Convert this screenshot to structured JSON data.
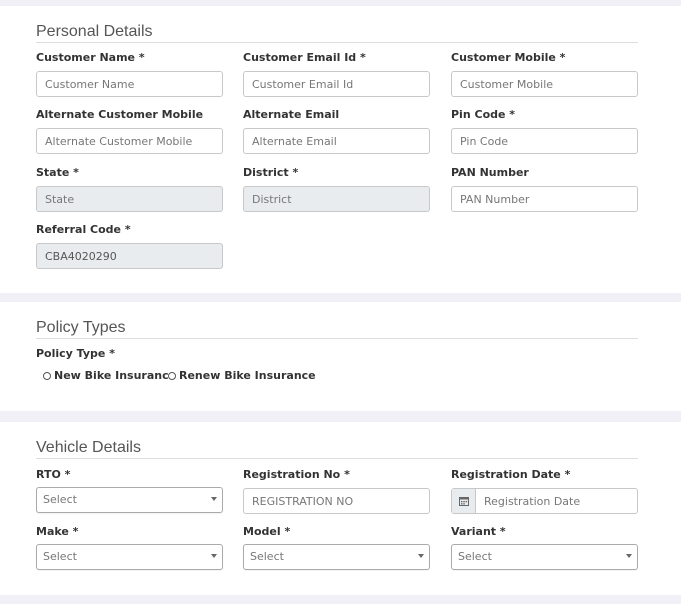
{
  "personal": {
    "title": "Personal Details",
    "fields": {
      "customer_name": {
        "label": "Customer Name *",
        "placeholder": "Customer Name"
      },
      "customer_email": {
        "label": "Customer Email Id *",
        "placeholder": "Customer Email Id"
      },
      "customer_mobile": {
        "label": "Customer Mobile *",
        "placeholder": "Customer Mobile"
      },
      "alt_mobile": {
        "label": "Alternate Customer Mobile",
        "placeholder": "Alternate Customer Mobile"
      },
      "alt_email": {
        "label": "Alternate Email",
        "placeholder": "Alternate Email"
      },
      "pin_code": {
        "label": "Pin Code *",
        "placeholder": "Pin Code"
      },
      "state": {
        "label": "State *",
        "placeholder": "State"
      },
      "district": {
        "label": "District *",
        "placeholder": "District"
      },
      "pan": {
        "label": "PAN Number",
        "placeholder": "PAN Number"
      },
      "referral": {
        "label": "Referral Code *",
        "value": "CBA4020290"
      }
    }
  },
  "policy": {
    "title": "Policy Types",
    "policy_type_label": "Policy Type *",
    "options": [
      "New Bike Insurance",
      "Renew Bike Insurance"
    ]
  },
  "vehicle": {
    "title": "Vehicle Details",
    "fields": {
      "rto": {
        "label": "RTO *",
        "value": "Select"
      },
      "registration_no": {
        "label": "Registration No *",
        "placeholder": "REGISTRATION NO"
      },
      "registration_date": {
        "label": "Registration Date *",
        "placeholder": "Registration Date"
      },
      "make": {
        "label": "Make *",
        "value": "Select"
      },
      "model": {
        "label": "Model *",
        "value": "Select"
      },
      "variant": {
        "label": "Variant *",
        "value": "Select"
      }
    }
  },
  "icons": {
    "calendar": "calendar-icon",
    "caret": "chevron-down-icon"
  },
  "colors": {
    "background": "#f1f0f7",
    "card": "#ffffff",
    "readonly": "#e9ecef"
  }
}
